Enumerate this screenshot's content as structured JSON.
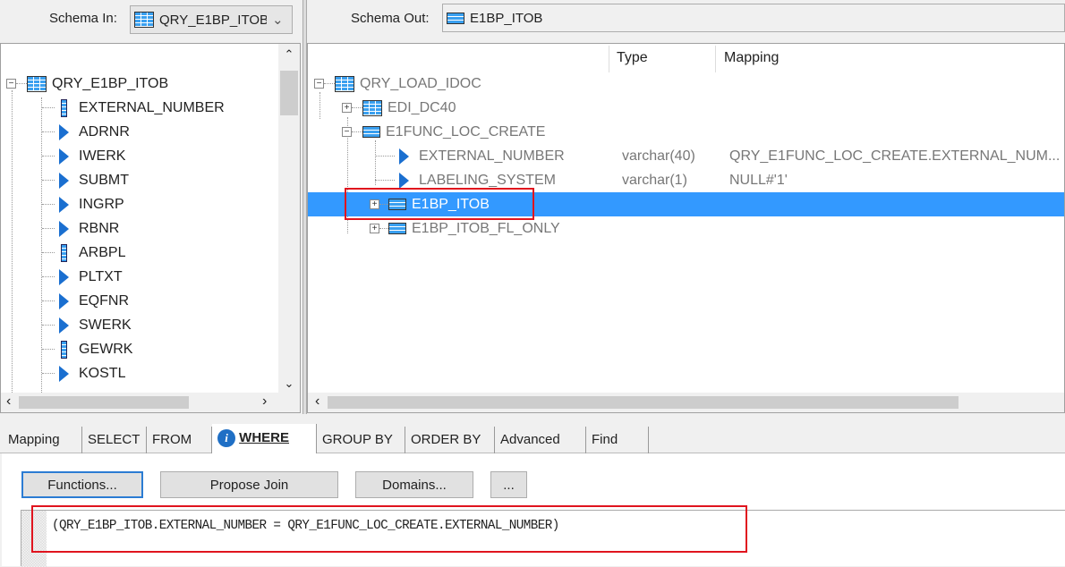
{
  "schema_in": {
    "label": "Schema In:",
    "value": "QRY_E1BP_ITOB"
  },
  "schema_out": {
    "label": "Schema Out:",
    "value": "E1BP_ITOB"
  },
  "left_tree": {
    "root": "QRY_E1BP_ITOB",
    "items": [
      {
        "name": "EXTERNAL_NUMBER",
        "icon": "key-column-icon"
      },
      {
        "name": "ADRNR",
        "icon": "column-arrow-icon"
      },
      {
        "name": "IWERK",
        "icon": "column-arrow-icon"
      },
      {
        "name": "SUBMT",
        "icon": "column-arrow-icon"
      },
      {
        "name": "INGRP",
        "icon": "column-arrow-icon"
      },
      {
        "name": "RBNR",
        "icon": "column-arrow-icon"
      },
      {
        "name": "ARBPL",
        "icon": "key-column-icon"
      },
      {
        "name": "PLTXT",
        "icon": "column-arrow-icon"
      },
      {
        "name": "EQFNR",
        "icon": "column-arrow-icon"
      },
      {
        "name": "SWERK",
        "icon": "column-arrow-icon"
      },
      {
        "name": "GEWRK",
        "icon": "key-column-icon"
      },
      {
        "name": "KOSTL",
        "icon": "column-arrow-icon"
      }
    ]
  },
  "right_tree": {
    "columns": [
      "Type",
      "Mapping"
    ],
    "root": "QRY_LOAD_IDOC",
    "edi": "EDI_DC40",
    "func": "E1FUNC_LOC_CREATE",
    "fields": [
      {
        "name": "EXTERNAL_NUMBER",
        "type": "varchar(40)",
        "mapping": "QRY_E1FUNC_LOC_CREATE.EXTERNAL_NUM..."
      },
      {
        "name": "LABELING_SYSTEM",
        "type": "varchar(1)",
        "mapping": "NULL#'1'"
      }
    ],
    "selected": "E1BP_ITOB",
    "last": "E1BP_ITOB_FL_ONLY"
  },
  "tabs": [
    "Mapping",
    "SELECT",
    "FROM",
    "WHERE",
    "GROUP BY",
    "ORDER BY",
    "Advanced",
    "Find"
  ],
  "buttons": {
    "functions": "Functions...",
    "propose": "Propose Join",
    "domains": "Domains...",
    "more": "..."
  },
  "where_clause": "(QRY_E1BP_ITOB.EXTERNAL_NUMBER = QRY_E1FUNC_LOC_CREATE.EXTERNAL_NUMBER)",
  "colors": {
    "selection": "#3399ff",
    "highlight": "#e0141e"
  }
}
